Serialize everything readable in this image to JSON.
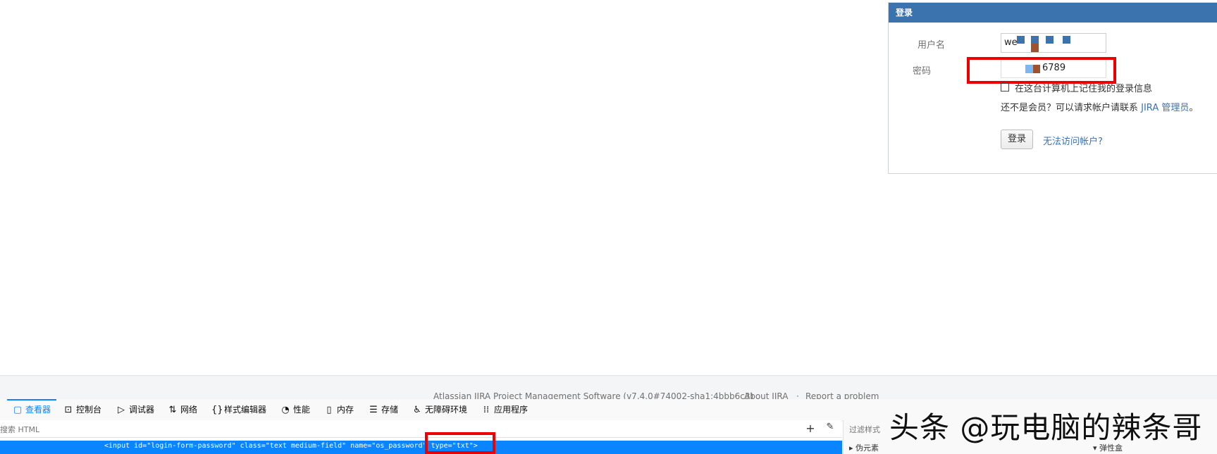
{
  "login": {
    "header": "登录",
    "username_label": "用户名",
    "username_value": "we",
    "password_label": "密码",
    "password_value": "6789",
    "remember_label": "在这台计算机上记住我的登录信息",
    "not_member_prefix": "还不是会员？可以请求帐户请联系 ",
    "admin_link": "JIRA 管理员",
    "not_member_suffix": "。",
    "login_button": "登录",
    "cannot_access_link": "无法访问帐户?"
  },
  "footer": {
    "product": "Atlassian JIRA Project Management Software (v7.4.0#74002-sha1:4bbb6c3)",
    "sep": "·",
    "about": "About JIRA",
    "report": "Report a problem"
  },
  "devtools": {
    "tabs": [
      {
        "label": "查看器",
        "icon": "inspector-icon"
      },
      {
        "label": "控制台",
        "icon": "console-icon"
      },
      {
        "label": "调试器",
        "icon": "debugger-icon"
      },
      {
        "label": "网络",
        "icon": "network-icon"
      },
      {
        "label": "样式编辑器",
        "icon": "style-editor-icon"
      },
      {
        "label": "性能",
        "icon": "performance-icon"
      },
      {
        "label": "内存",
        "icon": "memory-icon"
      },
      {
        "label": "存储",
        "icon": "storage-icon"
      },
      {
        "label": "无障碍环境",
        "icon": "accessibility-icon"
      },
      {
        "label": "应用程序",
        "icon": "application-icon"
      }
    ],
    "search_placeholder": "搜索 HTML",
    "selected_html": "<input id=\"login-form-password\" class=\"text medium-field\" name=\"os_password\" type=\"txt\">",
    "filter_placeholder": "过滤样式",
    "pseudo_elements": "伪元素",
    "flexbox": "弹性盒"
  },
  "watermark": "头条 @玩电脑的辣条哥",
  "colors": {
    "header_blue": "#3b73af",
    "highlight_red": "#ee0000",
    "devtools_selection": "#0a84ff"
  }
}
